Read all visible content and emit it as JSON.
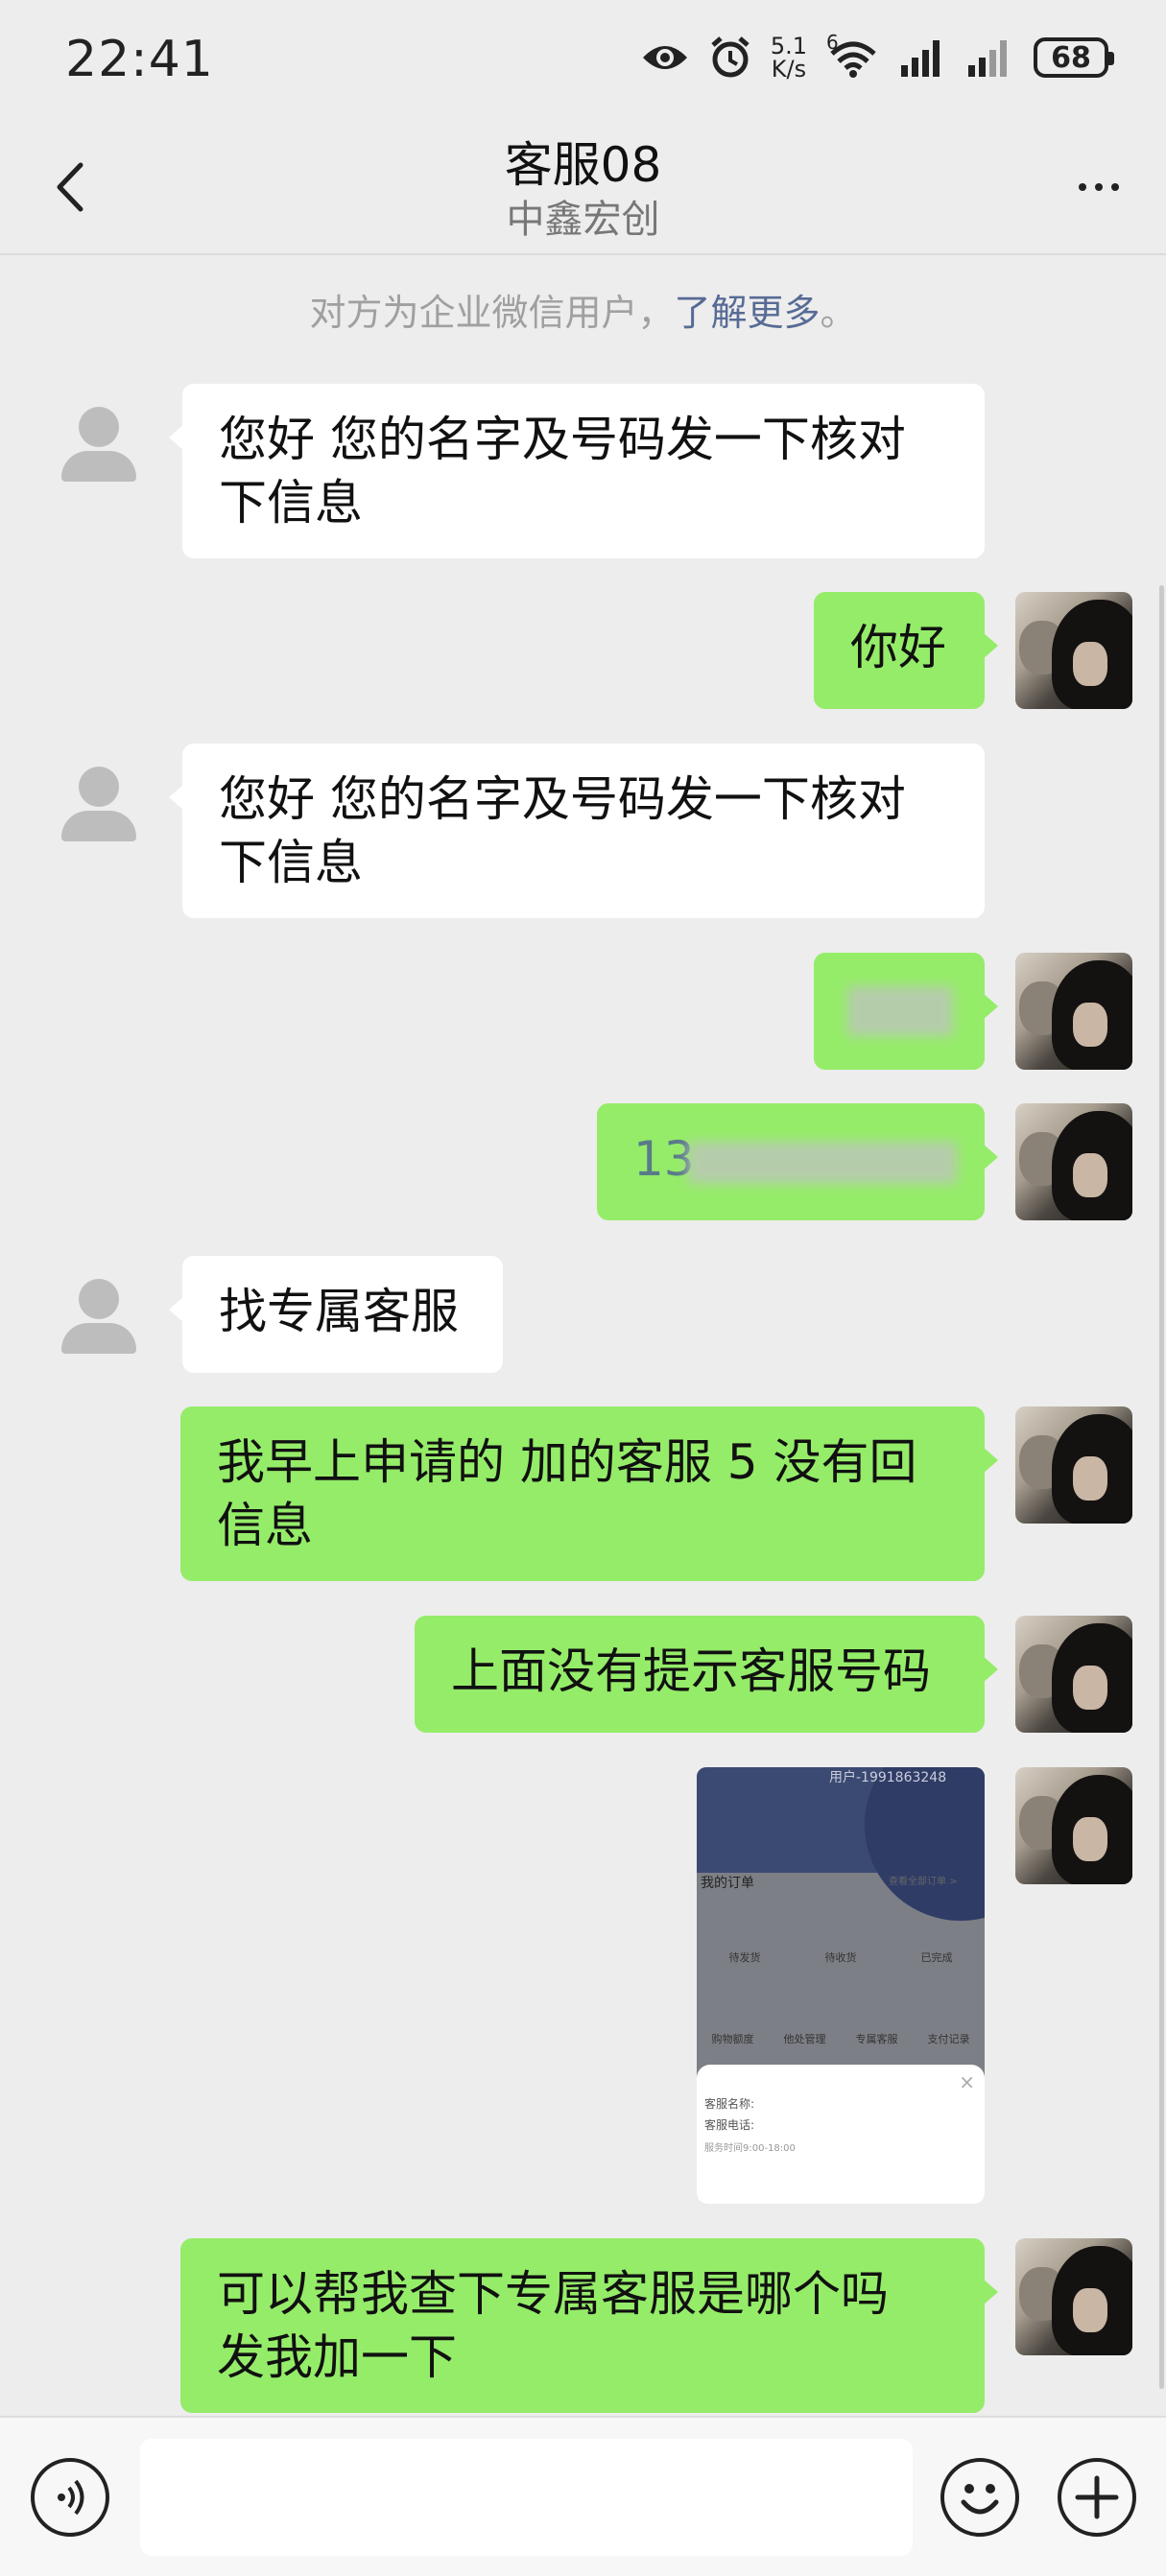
{
  "status_bar": {
    "time": "22:41",
    "net_speed_value": "5.1",
    "net_speed_unit": "K/s",
    "wifi_label": "6",
    "battery": "68",
    "icons": [
      "eye-icon",
      "alarm-icon",
      "wifi-icon",
      "signal-icon",
      "signal-icon",
      "battery-icon"
    ]
  },
  "header": {
    "title": "客服08",
    "subtitle": "中鑫宏创",
    "back_icon": "chevron-left-icon",
    "more_icon": "more-horizontal-icon"
  },
  "notice": {
    "text": "对方为企业微信用户，",
    "link": "了解更多",
    "end": "。"
  },
  "messages": [
    {
      "side": "left",
      "type": "text",
      "lines": [
        "您好 您的名字及号码发一下核对",
        "下信息"
      ]
    },
    {
      "side": "right",
      "type": "text",
      "lines": [
        "你好"
      ]
    },
    {
      "side": "left",
      "type": "text",
      "lines": [
        "您好 您的名字及号码发一下核对",
        "下信息"
      ]
    },
    {
      "side": "right",
      "type": "blurred",
      "lines": [
        ""
      ]
    },
    {
      "side": "right",
      "type": "blurred",
      "lines": [
        "13"
      ]
    },
    {
      "side": "left",
      "type": "text",
      "lines": [
        "找专属客服"
      ]
    },
    {
      "side": "right",
      "type": "text",
      "lines": [
        "我早上申请的 加的客服 5 没有回",
        "信息"
      ]
    },
    {
      "side": "right",
      "type": "text",
      "lines": [
        "上面没有提示客服号码"
      ]
    },
    {
      "side": "right",
      "type": "image",
      "lines": []
    },
    {
      "side": "right",
      "type": "text",
      "lines": [
        "可以帮我查下专属客服是哪个吗",
        "发我加一下"
      ]
    }
  ],
  "screenshot_image": {
    "user": "用户-1991863248",
    "orders": "我的订单",
    "orders_link": "查看全部订单 >",
    "order_items": [
      "待发货",
      "待收货",
      "已完成"
    ],
    "tool_items": [
      "购物额度",
      "他处管理",
      "专属客服",
      "支付记录"
    ],
    "popup_name": "客服名称:",
    "popup_phone": "客服电话:",
    "popup_hours": "服务时间9:00-18:00"
  },
  "input_bar": {
    "voice_icon": "voice-icon",
    "emoji_icon": "emoji-icon",
    "plus_icon": "plus-icon"
  }
}
